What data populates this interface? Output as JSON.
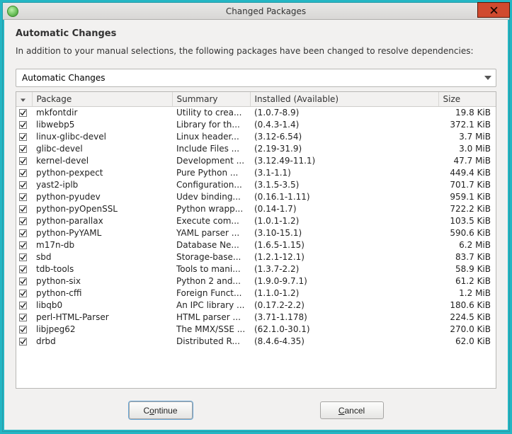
{
  "window": {
    "title": "Changed Packages"
  },
  "header": {
    "heading": "Automatic Changes",
    "description": "In addition to your manual selections, the following packages have been changed to resolve dependencies:"
  },
  "combo": {
    "selected": "Automatic Changes"
  },
  "columns": {
    "package": "Package",
    "summary": "Summary",
    "installed": "Installed (Available)",
    "size": "Size"
  },
  "rows": [
    {
      "pkg": "mkfontdir",
      "sum": "Utility to crea...",
      "inst": "(1.0.7-8.9)",
      "size": "19.8 KiB"
    },
    {
      "pkg": "libwebp5",
      "sum": "Library for th...",
      "inst": "(0.4.3-1.4)",
      "size": "372.1 KiB"
    },
    {
      "pkg": "linux-glibc-devel",
      "sum": "Linux header...",
      "inst": "(3.12-6.54)",
      "size": "3.7 MiB"
    },
    {
      "pkg": "glibc-devel",
      "sum": "Include Files ...",
      "inst": "(2.19-31.9)",
      "size": "3.0 MiB"
    },
    {
      "pkg": "kernel-devel",
      "sum": "Development ...",
      "inst": "(3.12.49-11.1)",
      "size": "47.7 MiB"
    },
    {
      "pkg": "python-pexpect",
      "sum": "Pure Python ...",
      "inst": "(3.1-1.1)",
      "size": "449.4 KiB"
    },
    {
      "pkg": "yast2-iplb",
      "sum": "Configuration...",
      "inst": "(3.1.5-3.5)",
      "size": "701.7 KiB"
    },
    {
      "pkg": "python-pyudev",
      "sum": "Udev binding...",
      "inst": "(0.16.1-1.11)",
      "size": "959.1 KiB"
    },
    {
      "pkg": "python-pyOpenSSL",
      "sum": "Python wrapp...",
      "inst": "(0.14-1.7)",
      "size": "722.2 KiB"
    },
    {
      "pkg": "python-parallax",
      "sum": "Execute com...",
      "inst": "(1.0.1-1.2)",
      "size": "103.5 KiB"
    },
    {
      "pkg": "python-PyYAML",
      "sum": "YAML parser ...",
      "inst": "(3.10-15.1)",
      "size": "590.6 KiB"
    },
    {
      "pkg": "m17n-db",
      "sum": "Database Ne...",
      "inst": "(1.6.5-1.15)",
      "size": "6.2 MiB"
    },
    {
      "pkg": "sbd",
      "sum": "Storage-base...",
      "inst": "(1.2.1-12.1)",
      "size": "83.7 KiB"
    },
    {
      "pkg": "tdb-tools",
      "sum": "Tools to mani...",
      "inst": "(1.3.7-2.2)",
      "size": "58.9 KiB"
    },
    {
      "pkg": "python-six",
      "sum": "Python 2 and...",
      "inst": "(1.9.0-9.7.1)",
      "size": "61.2 KiB"
    },
    {
      "pkg": "python-cffi",
      "sum": "Foreign Funct...",
      "inst": "(1.1.0-1.2)",
      "size": "1.2 MiB"
    },
    {
      "pkg": "libqb0",
      "sum": "An IPC library ...",
      "inst": "(0.17.2-2.2)",
      "size": "180.6 KiB"
    },
    {
      "pkg": "perl-HTML-Parser",
      "sum": "HTML parser ...",
      "inst": "(3.71-1.178)",
      "size": "224.5 KiB"
    },
    {
      "pkg": "libjpeg62",
      "sum": "The MMX/SSE ...",
      "inst": "(62.1.0-30.1)",
      "size": "270.0 KiB"
    },
    {
      "pkg": "drbd",
      "sum": "Distributed R...",
      "inst": "(8.4.6-4.35)",
      "size": "62.0 KiB"
    }
  ],
  "buttons": {
    "continue_pre": "C",
    "continue_u": "o",
    "continue_post": "ntinue",
    "cancel_u": "C",
    "cancel_post": "ancel"
  }
}
